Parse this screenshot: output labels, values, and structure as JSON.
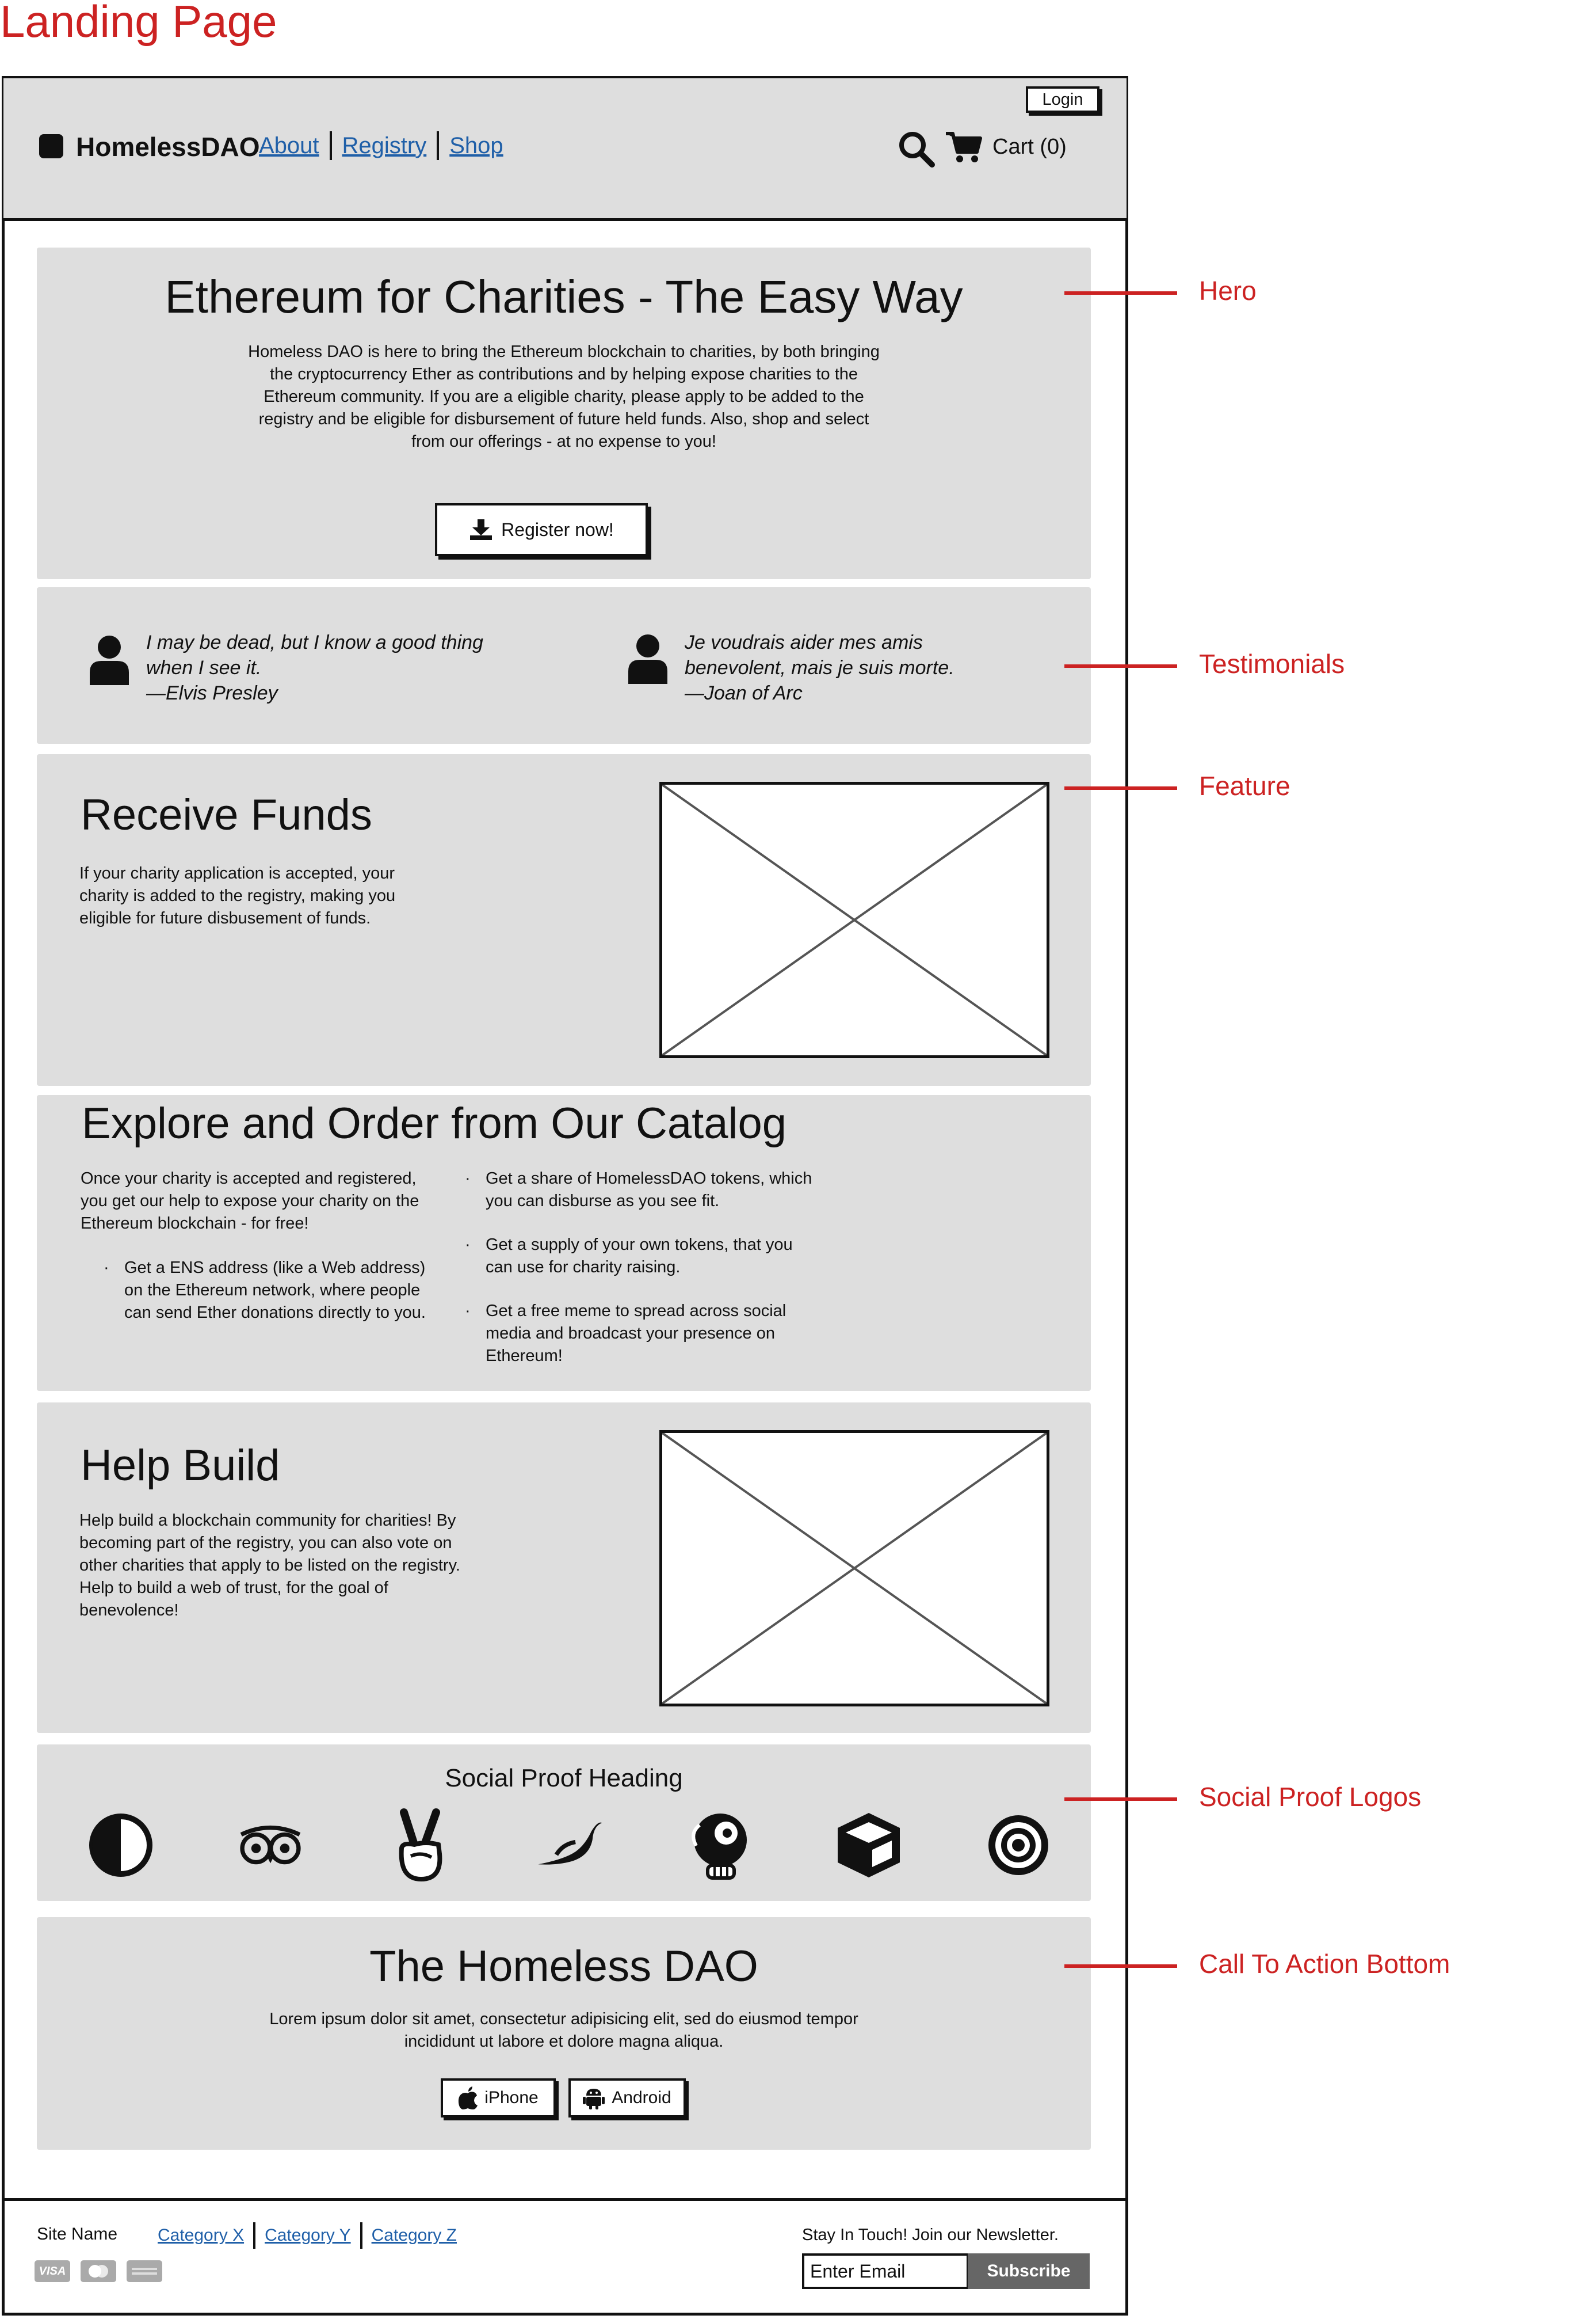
{
  "page_label": "Landing Page",
  "header": {
    "login": "Login",
    "brand": "HomelessDAO",
    "nav": [
      "About",
      "Registry",
      "Shop"
    ],
    "cart": "Cart (0)"
  },
  "hero": {
    "title": "Ethereum for Charities - The Easy Way",
    "text": "Homeless DAO is here to bring the Ethereum blockchain to charities, by both bringing the cryptocurrency Ether as contributions and by helping expose charities to the Ethereum community.  If you are a eligible charity, please apply to be added to the registry and be eligible for disbursement of future held funds.  Also, shop and select from our offerings - at no expense to you!",
    "button": "Register now!"
  },
  "testimonials": [
    {
      "line1": "I may be dead, but I know a good thing",
      "line2": "when I see it.",
      "author": "—Elvis Presley"
    },
    {
      "line1": "Je voudrais aider mes amis",
      "line2": "benevolent, mais je suis morte.",
      "author": "—Joan of Arc"
    }
  ],
  "feature1": {
    "title": "Receive Funds",
    "text": "If your charity application is accepted, your charity is added to the registry, making you eligible for future disbusement of funds."
  },
  "catalog": {
    "title": "Explore and Order from Our Catalog",
    "intro": "Once your charity is accepted and registered, you get our help to expose your charity on the Ethereum blockchain - for free!",
    "left_bullet": "Get a ENS address (like a Web address) on the Ethereum network, where people can send Ether donations directly to you.",
    "right_bullets": [
      "Get a share of HomelessDAO tokens, which you can disburse as you see fit.",
      "Get a supply of your own tokens, that you can use for charity raising.",
      "Get a free meme to spread across social media and broadcast your presence on Ethereum!"
    ]
  },
  "feature2": {
    "title": "Help Build",
    "text": "Help build a blockchain community for charities!  By becoming part of the registry, you can also vote on other charities that apply to be listed on the registry.  Help to build a web of trust, for the goal of benevolence!"
  },
  "social": {
    "heading": "Social Proof Heading",
    "logos": [
      "half-circle-icon",
      "owl-icon",
      "peace-hand-icon",
      "bird-icon",
      "parrot-icon",
      "cube-icon",
      "target-icon"
    ]
  },
  "cta": {
    "title": "The Homeless DAO",
    "text": "Lorem ipsum dolor sit amet, consectetur adipisicing elit, sed do eiusmod tempor incididunt ut labore et dolore magna aliqua.",
    "iphone": "iPhone",
    "android": "Android"
  },
  "footer": {
    "site_name": "Site Name",
    "links": [
      "Category X",
      "Category Y",
      "Category Z"
    ],
    "payments": [
      "VISA"
    ],
    "newsletter": "Stay In Touch! Join our Newsletter.",
    "email_placeholder": "Enter Email",
    "subscribe": "Subscribe"
  },
  "annotations": [
    "Hero",
    "Testimonials",
    "Feature",
    "Social Proof Logos",
    "Call To Action Bottom"
  ],
  "colors": {
    "annotation": "#cc2222",
    "panel": "#dedede",
    "link": "#1f5fa8"
  }
}
